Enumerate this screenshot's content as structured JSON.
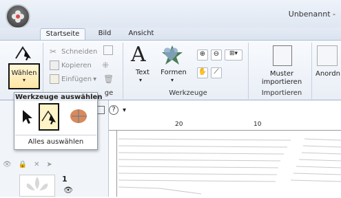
{
  "window": {
    "title": "Unbenannt -"
  },
  "tabs": [
    {
      "label": "Startseite",
      "active": true
    },
    {
      "label": "Bild",
      "active": false
    },
    {
      "label": "Ansicht",
      "active": false
    }
  ],
  "ribbon": {
    "select": {
      "label": "Wählen"
    },
    "clipboard": {
      "cut": "Schneiden",
      "copy": "Kopieren",
      "paste": "Einfügen",
      "group": "ge"
    },
    "tools": {
      "text": "Text",
      "shapes": "Formen",
      "group": "Werkzeuge"
    },
    "import": {
      "pattern_line1": "Muster",
      "pattern_line2": "importieren",
      "group": "Importieren"
    },
    "arrange": {
      "label": "Anordn"
    }
  },
  "popup": {
    "title": "Werkzeuge auswählen",
    "select_all": "Alles auswählen"
  },
  "qat": {
    "help": "?",
    "dropdown": "▾"
  },
  "ruler": {
    "marks": [
      "20",
      "10"
    ]
  },
  "layers": {
    "item_number": "1"
  }
}
